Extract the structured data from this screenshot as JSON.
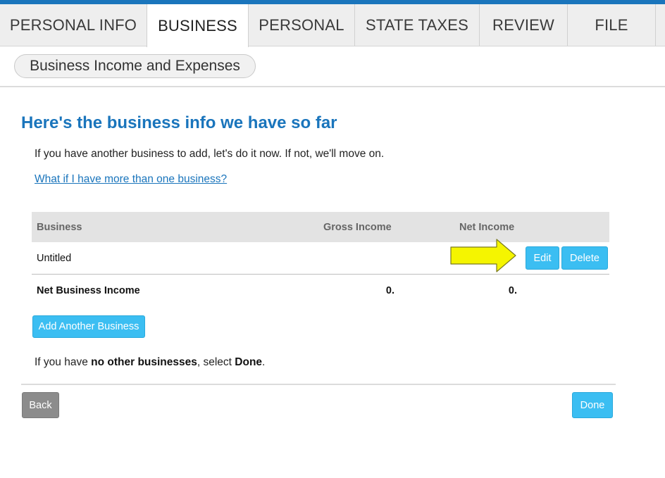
{
  "tabs": [
    {
      "label": "PERSONAL INFO",
      "active": false
    },
    {
      "label": "BUSINESS",
      "active": true
    },
    {
      "label": "PERSONAL",
      "active": false
    },
    {
      "label": "STATE TAXES",
      "active": false
    },
    {
      "label": "REVIEW",
      "active": false
    },
    {
      "label": "FILE",
      "active": false
    }
  ],
  "subnav": {
    "pill_label": "Business Income and Expenses"
  },
  "main": {
    "title": "Here's the business info we have so far",
    "intro": "If you have another business to add, let's do it now. If not, we'll move on.",
    "help_link": "What if I have more than one business?"
  },
  "table": {
    "headers": [
      "Business",
      "Gross Income",
      "Net Income"
    ],
    "rows": [
      {
        "business": "Untitled",
        "gross_income": "",
        "net_income": "",
        "edit_label": "Edit",
        "delete_label": "Delete"
      }
    ],
    "total": {
      "label": "Net Business Income",
      "gross_income": "0.",
      "net_income": "0."
    }
  },
  "actions": {
    "add_business_label": "Add Another Business"
  },
  "note": {
    "prefix": "If you have ",
    "bold1": "no other businesses",
    "middle": ", select ",
    "bold2": "Done",
    "suffix": "."
  },
  "footer": {
    "back_label": "Back",
    "done_label": "Done"
  },
  "colors": {
    "brand_blue": "#1a75bc",
    "button_blue": "#3bbef2",
    "button_gray": "#8c8c8c",
    "arrow_yellow": "#f5f500"
  },
  "icons": {
    "annotation": "yellow-arrow-icon"
  }
}
